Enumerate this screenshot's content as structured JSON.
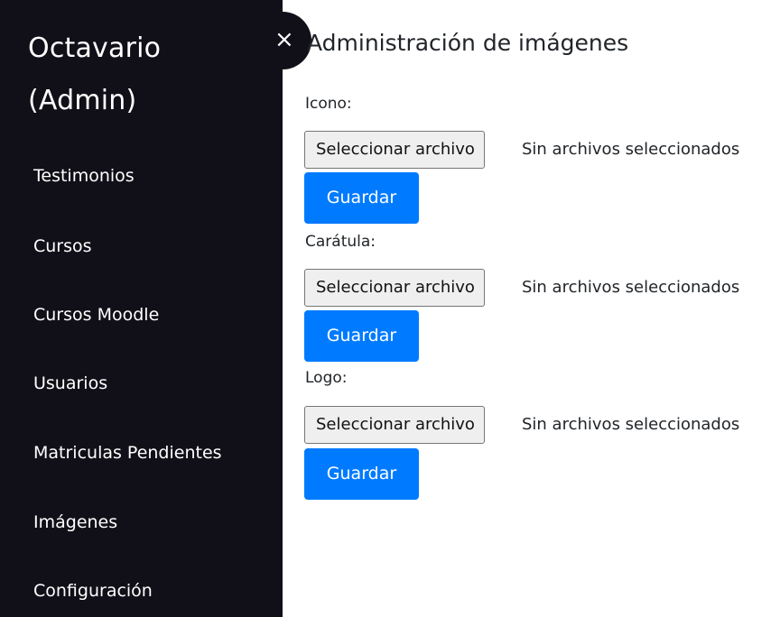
{
  "sidebar": {
    "brand_line1": "Octavario",
    "brand_line2": "(Admin)",
    "close_glyph": "×",
    "items": [
      {
        "label": "Testimonios"
      },
      {
        "label": "Cursos"
      },
      {
        "label": "Cursos Moodle"
      },
      {
        "label": "Usuarios"
      },
      {
        "label": "Matriculas Pendientes"
      },
      {
        "label": "Imágenes"
      },
      {
        "label": "Configuración"
      }
    ]
  },
  "main": {
    "title": "Administración de imágenes",
    "sections": [
      {
        "label": "Icono:",
        "file_button": "Seleccionar archivo",
        "file_status": "Sin archivos seleccionados",
        "save_label": "Guardar"
      },
      {
        "label": "Carátula:",
        "file_button": "Seleccionar archivo",
        "file_status": "Sin archivos seleccionados",
        "save_label": "Guardar"
      },
      {
        "label": "Logo:",
        "file_button": "Seleccionar archivo",
        "file_status": "Sin archivos seleccionados",
        "save_label": "Guardar"
      }
    ]
  },
  "colors": {
    "sidebar_bg": "#111018",
    "primary": "#007bff",
    "file_button_bg": "#efefef",
    "text": "#212529"
  }
}
